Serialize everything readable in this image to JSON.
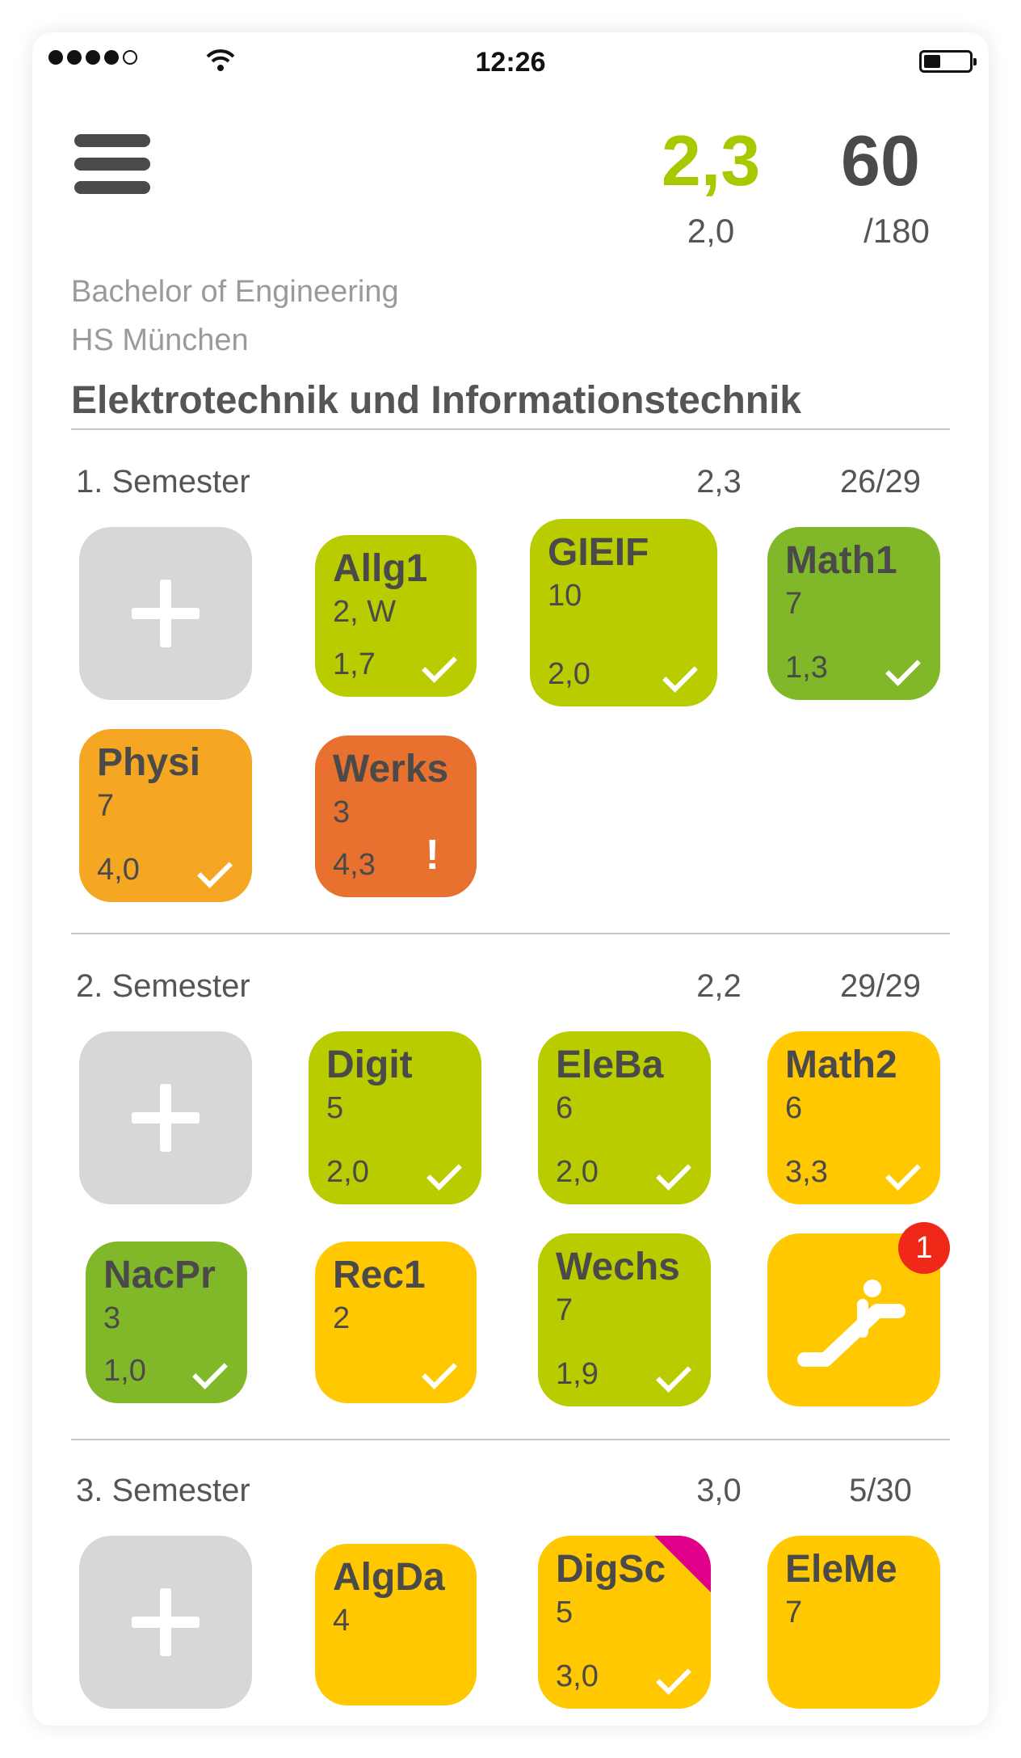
{
  "status_bar": {
    "time": "12:26",
    "signal_bars": 4,
    "battery_level": 0.3
  },
  "header": {
    "average_grade": "2,3",
    "reference_grade": "2,0",
    "credits": "60",
    "credits_total": "/180",
    "degree": "Bachelor of Engineering",
    "school": "HS München",
    "program": "Elektrotechnik und Informationstechnik"
  },
  "colors": {
    "lime": "#b8cc00",
    "green": "#80b82a",
    "yellow": "#ffc800",
    "orange": "#f5a623",
    "dark_orange": "#e8712f",
    "add_gray": "#d7d7d7",
    "flag_pink": "#e0008a",
    "badge_red": "#f02818"
  },
  "semesters": [
    {
      "title": "1. Semester",
      "grade": "2,3",
      "credits": "26/29",
      "modules": [
        {
          "abbr": "Allg1",
          "cp": "2, W",
          "grade": "1,7",
          "status": "check",
          "color": "lime"
        },
        {
          "abbr": "GIEIF",
          "cp": "10",
          "grade": "2,0",
          "status": "check",
          "color": "lime"
        },
        {
          "abbr": "Math1",
          "cp": "7",
          "grade": "1,3",
          "status": "check",
          "color": "green"
        },
        {
          "abbr": "Physi",
          "cp": "7",
          "grade": "4,0",
          "status": "check",
          "color": "orange"
        },
        {
          "abbr": "Werks",
          "cp": "3",
          "grade": "4,3",
          "status": "warning",
          "warning_symbol": "!",
          "color": "dark_orange"
        }
      ]
    },
    {
      "title": "2. Semester",
      "grade": "2,2",
      "credits": "29/29",
      "modules": [
        {
          "abbr": "Digit",
          "cp": "5",
          "grade": "2,0",
          "status": "check",
          "color": "lime"
        },
        {
          "abbr": "EleBa",
          "cp": "6",
          "grade": "2,0",
          "status": "check",
          "color": "lime"
        },
        {
          "abbr": "Math2",
          "cp": "6",
          "grade": "3,3",
          "status": "check",
          "color": "yellow"
        },
        {
          "abbr": "NacPr",
          "cp": "3",
          "grade": "1,0",
          "status": "check",
          "color": "green"
        },
        {
          "abbr": "Rec1",
          "cp": "2",
          "grade": "",
          "status": "check",
          "color": "yellow"
        },
        {
          "abbr": "Wechs",
          "cp": "7",
          "grade": "1,9",
          "status": "check",
          "color": "lime"
        }
      ],
      "special_tile": {
        "icon": "escalator-icon",
        "badge": "1",
        "color": "yellow"
      }
    },
    {
      "title": "3. Semester",
      "grade": "3,0",
      "credits": "5/30",
      "modules": [
        {
          "abbr": "AlgDa",
          "cp": "4",
          "grade": "",
          "status": "",
          "color": "yellow"
        },
        {
          "abbr": "DigSc",
          "cp": "5",
          "grade": "3,0",
          "status": "check",
          "color": "yellow",
          "flag": "pink"
        },
        {
          "abbr": "EleMe",
          "cp": "7",
          "grade": "",
          "status": "",
          "color": "yellow"
        }
      ]
    }
  ]
}
